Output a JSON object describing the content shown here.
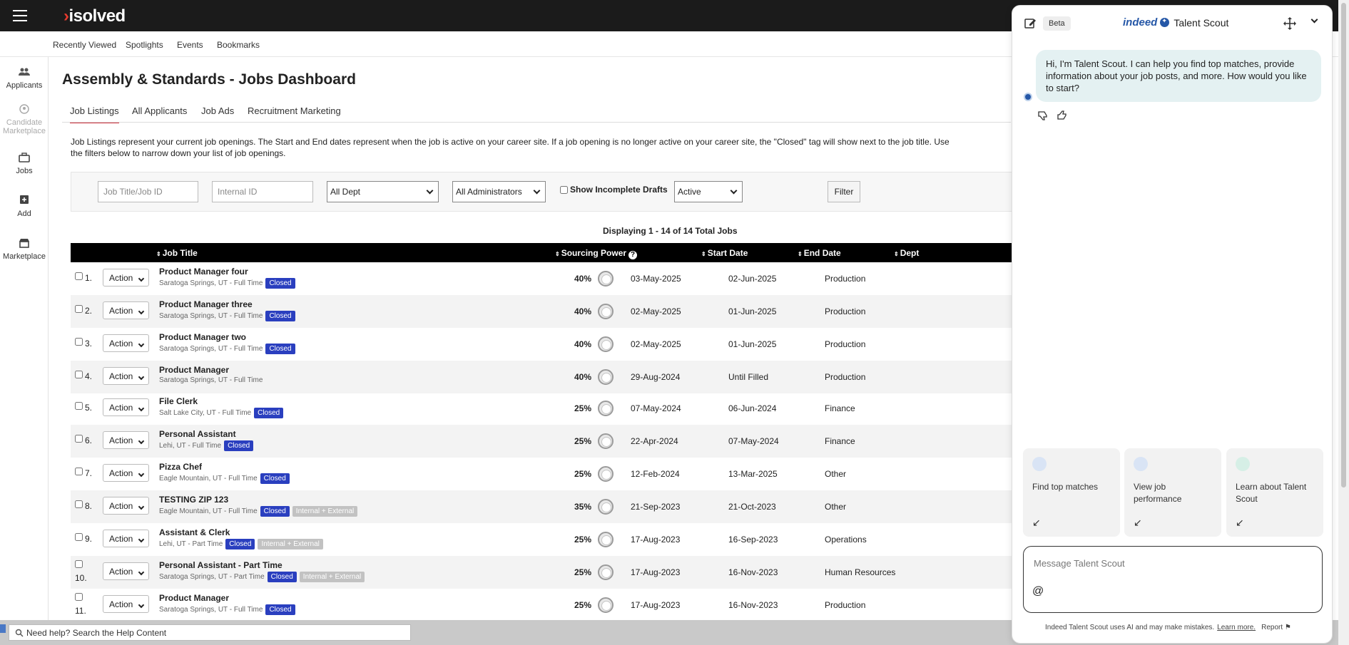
{
  "app": {
    "logo": "isolved"
  },
  "subnav": [
    "Recently Viewed",
    "Spotlights",
    "Events",
    "Bookmarks"
  ],
  "rail": [
    {
      "label": "Applicants",
      "icon": "people-icon"
    },
    {
      "label": "Candidate Marketplace",
      "icon": "candidate-icon"
    },
    {
      "label": "Jobs",
      "icon": "briefcase-icon"
    },
    {
      "label": "Add",
      "icon": "add-icon"
    },
    {
      "label": "Marketplace",
      "icon": "store-icon"
    }
  ],
  "page": {
    "title": "Assembly & Standards - Jobs Dashboard",
    "tabs": [
      "Job Listings",
      "All Applicants",
      "Job Ads",
      "Recruitment Marketing"
    ],
    "active_tab": "Job Listings",
    "intro": "Job Listings represent your current job openings. The Start and End dates represent when the job is active on your career site. If a job opening is no longer active on your career site, the \"Closed\" tag will show next to the job title. Use the filters below to narrow down your list of job openings."
  },
  "filters": {
    "job_title_placeholder": "Job Title/Job ID",
    "internal_id_placeholder": "Internal ID",
    "dept": "All Dept",
    "admins": "All Administrators",
    "incomplete_drafts": "Show Incomplete Drafts",
    "status": "Active",
    "filter_button": "Filter"
  },
  "table": {
    "displaying": "Displaying 1 - 14 of 14 Total Jobs",
    "columns": [
      "Job Title",
      "Sourcing Power",
      "Start Date",
      "End Date",
      "Dept"
    ],
    "action_label": "Action",
    "rows": [
      {
        "num": "1.",
        "title": "Product Manager four",
        "sub": "Saratoga Springs, UT - Full Time",
        "badges": [
          "Closed"
        ],
        "power": "40%",
        "start": "03-May-2025",
        "end": "02-Jun-2025",
        "dept": "Production"
      },
      {
        "num": "2.",
        "title": "Product Manager three",
        "sub": "Saratoga Springs, UT - Full Time",
        "badges": [
          "Closed"
        ],
        "power": "40%",
        "start": "02-May-2025",
        "end": "01-Jun-2025",
        "dept": "Production"
      },
      {
        "num": "3.",
        "title": "Product Manager two",
        "sub": "Saratoga Springs, UT - Full Time",
        "badges": [
          "Closed"
        ],
        "power": "40%",
        "start": "02-May-2025",
        "end": "01-Jun-2025",
        "dept": "Production"
      },
      {
        "num": "4.",
        "title": "Product Manager",
        "sub": "Saratoga Springs, UT - Full Time",
        "badges": [],
        "power": "40%",
        "start": "29-Aug-2024",
        "end": "Until Filled",
        "dept": "Production"
      },
      {
        "num": "5.",
        "title": "File Clerk",
        "sub": "Salt Lake City, UT - Full Time",
        "badges": [
          "Closed"
        ],
        "power": "25%",
        "start": "07-May-2024",
        "end": "06-Jun-2024",
        "dept": "Finance"
      },
      {
        "num": "6.",
        "title": "Personal Assistant",
        "sub": "Lehi, UT - Full Time",
        "badges": [
          "Closed"
        ],
        "power": "25%",
        "start": "22-Apr-2024",
        "end": "07-May-2024",
        "dept": "Finance"
      },
      {
        "num": "7.",
        "title": "Pizza Chef",
        "sub": "Eagle Mountain, UT - Full Time",
        "badges": [
          "Closed"
        ],
        "power": "25%",
        "start": "12-Feb-2024",
        "end": "13-Mar-2025",
        "dept": "Other"
      },
      {
        "num": "8.",
        "title": "TESTING ZIP 123",
        "sub": "Eagle Mountain, UT - Full Time",
        "badges": [
          "Closed",
          "Internal + External"
        ],
        "power": "35%",
        "start": "21-Sep-2023",
        "end": "21-Oct-2023",
        "dept": "Other"
      },
      {
        "num": "9.",
        "title": "Assistant & Clerk",
        "sub": "Lehi, UT - Part Time",
        "badges": [
          "Closed",
          "Internal + External"
        ],
        "power": "25%",
        "start": "17-Aug-2023",
        "end": "16-Sep-2023",
        "dept": "Operations"
      },
      {
        "num": "10.",
        "title": "Personal Assistant - Part Time",
        "sub": "Saratoga Springs, UT - Part Time",
        "badges": [
          "Closed",
          "Internal + External"
        ],
        "power": "25%",
        "start": "17-Aug-2023",
        "end": "16-Nov-2023",
        "dept": "Human Resources"
      },
      {
        "num": "11.",
        "title": "Product Manager",
        "sub": "Saratoga Springs, UT - Full Time",
        "badges": [
          "Closed"
        ],
        "power": "25%",
        "start": "17-Aug-2023",
        "end": "16-Nov-2023",
        "dept": "Production"
      }
    ]
  },
  "help": {
    "placeholder": "Need help? Search the Help Content"
  },
  "scout": {
    "beta": "Beta",
    "brand": "indeed",
    "name": "Talent Scout",
    "greeting": "Hi, I'm Talent Scout. I can help you find top matches, provide information about your job posts, and more. How would you like to start?",
    "cards": [
      {
        "label": "Find top matches",
        "icon": "search-match-icon"
      },
      {
        "label": "View job performance",
        "icon": "briefcase-icon"
      },
      {
        "label": "Learn about Talent Scout",
        "icon": "lightbulb-icon"
      }
    ],
    "input_placeholder": "Message Talent Scout",
    "footer": "Indeed Talent Scout uses AI and may make mistakes.",
    "learn_more": "Learn more.",
    "report": "Report"
  },
  "colors": {
    "topbar": "#1b1b1b",
    "closed_badge": "#2a3fbf",
    "tab_accent": "#cc2a36",
    "scout_bubble": "#e4f1f2",
    "indeed_blue": "#2557a7"
  }
}
